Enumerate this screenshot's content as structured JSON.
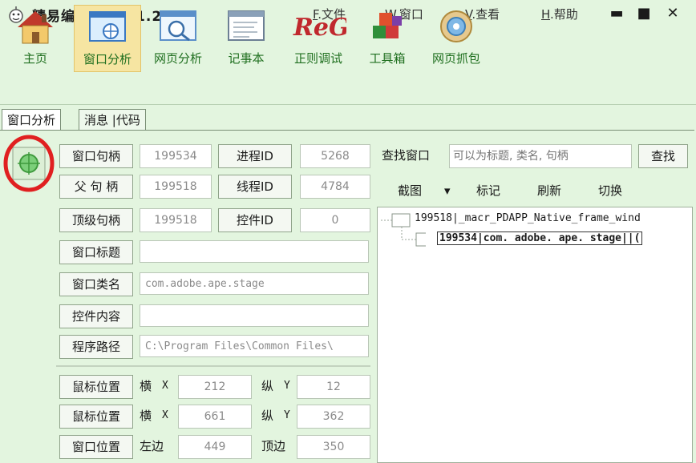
{
  "app": {
    "title": "精易编程助手 V1.2",
    "menu": [
      {
        "accel": "F",
        "label": ".文件"
      },
      {
        "accel": "W",
        "label": ".窗口"
      },
      {
        "accel": "V",
        "label": ".查看"
      },
      {
        "accel": "H",
        "label": ".帮助"
      }
    ],
    "controls": {
      "minimize": "▬",
      "maximize": "■",
      "close": "✕"
    }
  },
  "toolbar": {
    "items": [
      {
        "label": "主页",
        "icon": "house-icon"
      },
      {
        "label": "窗口分析",
        "icon": "window-target-icon",
        "active": true
      },
      {
        "label": "网页分析",
        "icon": "web-magnifier-icon"
      },
      {
        "label": "记事本",
        "icon": "notepad-icon"
      },
      {
        "label": "正则调试",
        "icon": "regex-icon",
        "logo_text": "ReG"
      },
      {
        "label": "工具箱",
        "icon": "toolbox-blocks-icon"
      },
      {
        "label": "网页抓包",
        "icon": "disc-capture-icon"
      }
    ]
  },
  "tabs": [
    {
      "label": "窗口分析",
      "active": true
    },
    {
      "label": "消息 |代码",
      "active": false
    }
  ],
  "analysis": {
    "rows": [
      {
        "button": "窗口句柄",
        "value": "199534",
        "mid_button": "进程ID",
        "mid_value": "5268"
      },
      {
        "button": "父 句 柄",
        "value": "199518",
        "mid_button": "线程ID",
        "mid_value": "4784"
      },
      {
        "button": "顶级句柄",
        "value": "199518",
        "mid_button": "控件ID",
        "mid_value": "0"
      }
    ],
    "window_title": {
      "button": "窗口标题",
      "value": ""
    },
    "window_class": {
      "button": "窗口类名",
      "value": "com.adobe.ape.stage"
    },
    "control_content": {
      "button": "控件内容",
      "value": ""
    },
    "program_path": {
      "button": "程序路径",
      "value": "C:\\Program Files\\Common Files\\"
    },
    "mouse_rows": [
      {
        "button": "鼠标位置",
        "xlabel": "横",
        "xaxis": "X",
        "x": "212",
        "ylabel": "纵",
        "yaxis": "Y",
        "y": "12"
      },
      {
        "button": "鼠标位置",
        "xlabel": "横",
        "xaxis": "X",
        "x": "661",
        "ylabel": "纵",
        "yaxis": "Y",
        "y": "362"
      }
    ],
    "window_pos": {
      "button": "窗口位置",
      "left_label": "左边",
      "left": "449",
      "top_label": "顶边",
      "top": "350"
    }
  },
  "find": {
    "label": "查找窗口",
    "placeholder": "可以为标题, 类名, 句柄",
    "button": "查找"
  },
  "actions": {
    "screenshot": "截图",
    "mark": "标记",
    "refresh": "刷新",
    "switch": "切换",
    "dropdown": "▾"
  },
  "tree": {
    "nodes": [
      {
        "handle": "199518",
        "cls": "_macr_PDAPP_Native_frame_wind"
      },
      {
        "handle": "199534",
        "cls": "com. adobe. ape. stage",
        "suffix": "||(",
        "selected": true
      }
    ]
  },
  "colors": {
    "accent_green": "#1f6f1f",
    "active_tab": "#f6e5a2",
    "annotation_red": "#e02020"
  }
}
